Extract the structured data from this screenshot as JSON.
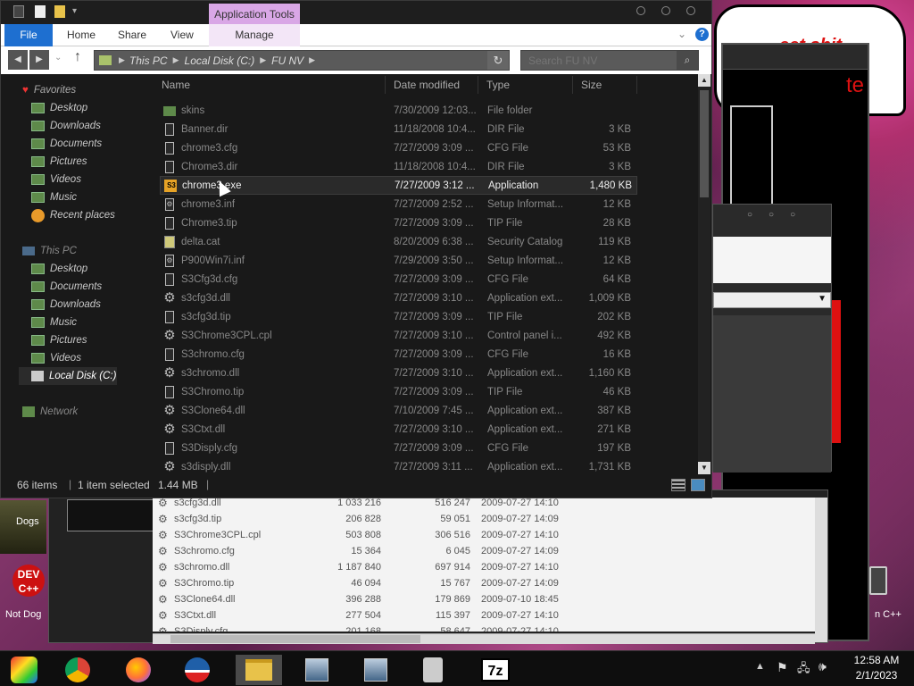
{
  "explorer": {
    "context_tab": "Application Tools",
    "tabs": [
      "File",
      "Home",
      "Share",
      "View",
      "Manage"
    ],
    "breadcrumb": [
      "This PC",
      "Local Disk (C:)",
      "FU NV"
    ],
    "search_placeholder": "Search FU NV",
    "columns": [
      "Name",
      "Date modified",
      "Type",
      "Size"
    ],
    "nav": {
      "favorites": "Favorites",
      "fav_items": [
        "Desktop",
        "Downloads",
        "Documents",
        "Pictures",
        "Videos",
        "Music",
        "Recent places"
      ],
      "this_pc": "This PC",
      "pc_items": [
        "Desktop",
        "Documents",
        "Downloads",
        "Music",
        "Pictures",
        "Videos",
        "Local Disk (C:)"
      ],
      "network": "Network"
    },
    "files": [
      {
        "name": "skins",
        "date": "7/30/2009 12:03...",
        "type": "File folder",
        "size": "",
        "icon": "folder-icon"
      },
      {
        "name": "Banner.dir",
        "date": "11/18/2008 10:4...",
        "type": "DIR File",
        "size": "3 KB",
        "icon": "file-icon"
      },
      {
        "name": "chrome3.cfg",
        "date": "7/27/2009 3:09 ...",
        "type": "CFG File",
        "size": "53 KB",
        "icon": "file-icon"
      },
      {
        "name": "Chrome3.dir",
        "date": "11/18/2008 10:4...",
        "type": "DIR File",
        "size": "3 KB",
        "icon": "file-icon"
      },
      {
        "name": "chrome3.exe",
        "date": "7/27/2009 3:12 ...",
        "type": "Application",
        "size": "1,480 KB",
        "icon": "s3-app-icon"
      },
      {
        "name": "chrome3.inf",
        "date": "7/27/2009 2:52 ...",
        "type": "Setup Informat...",
        "size": "12 KB",
        "icon": "setup-icon"
      },
      {
        "name": "Chrome3.tip",
        "date": "7/27/2009 3:09 ...",
        "type": "TIP File",
        "size": "28 KB",
        "icon": "file-icon"
      },
      {
        "name": "delta.cat",
        "date": "8/20/2009 6:38 ...",
        "type": "Security Catalog",
        "size": "119 KB",
        "icon": "catalog-icon"
      },
      {
        "name": "P900Win7i.inf",
        "date": "7/29/2009 3:50 ...",
        "type": "Setup Informat...",
        "size": "12 KB",
        "icon": "setup-icon"
      },
      {
        "name": "S3Cfg3d.cfg",
        "date": "7/27/2009 3:09 ...",
        "type": "CFG File",
        "size": "64 KB",
        "icon": "file-icon"
      },
      {
        "name": "s3cfg3d.dll",
        "date": "7/27/2009 3:10 ...",
        "type": "Application ext...",
        "size": "1,009 KB",
        "icon": "gear-icon"
      },
      {
        "name": "s3cfg3d.tip",
        "date": "7/27/2009 3:09 ...",
        "type": "TIP File",
        "size": "202 KB",
        "icon": "file-icon"
      },
      {
        "name": "S3Chrome3CPL.cpl",
        "date": "7/27/2009 3:10 ...",
        "type": "Control panel i...",
        "size": "492 KB",
        "icon": "gear-icon"
      },
      {
        "name": "S3chromo.cfg",
        "date": "7/27/2009 3:09 ...",
        "type": "CFG File",
        "size": "16 KB",
        "icon": "file-icon"
      },
      {
        "name": "s3chromo.dll",
        "date": "7/27/2009 3:10 ...",
        "type": "Application ext...",
        "size": "1,160 KB",
        "icon": "gear-icon"
      },
      {
        "name": "S3Chromo.tip",
        "date": "7/27/2009 3:09 ...",
        "type": "TIP File",
        "size": "46 KB",
        "icon": "file-icon"
      },
      {
        "name": "S3Clone64.dll",
        "date": "7/10/2009 7:45 ...",
        "type": "Application ext...",
        "size": "387 KB",
        "icon": "gear-icon"
      },
      {
        "name": "S3Ctxt.dll",
        "date": "7/27/2009 3:10 ...",
        "type": "Application ext...",
        "size": "271 KB",
        "icon": "gear-icon"
      },
      {
        "name": "S3Disply.cfg",
        "date": "7/27/2009 3:09 ...",
        "type": "CFG File",
        "size": "197 KB",
        "icon": "file-icon"
      },
      {
        "name": "s3disply.dll",
        "date": "7/27/2009 3:11 ...",
        "type": "Application ext...",
        "size": "1,731 KB",
        "icon": "gear-icon"
      }
    ],
    "status": {
      "count": "66 items",
      "selected": "1 item selected",
      "size": "1.44 MB"
    }
  },
  "background_list": {
    "rows": [
      {
        "name": "s3cfg3d.dll",
        "size": "1 033 216",
        "packed": "516 247",
        "date": "2009-07-27 14:10"
      },
      {
        "name": "s3cfg3d.tip",
        "size": "206 828",
        "packed": "59 051",
        "date": "2009-07-27 14:09"
      },
      {
        "name": "S3Chrome3CPL.cpl",
        "size": "503 808",
        "packed": "306 516",
        "date": "2009-07-27 14:10"
      },
      {
        "name": "S3chromo.cfg",
        "size": "15 364",
        "packed": "6 045",
        "date": "2009-07-27 14:09"
      },
      {
        "name": "s3chromo.dll",
        "size": "1 187 840",
        "packed": "697 914",
        "date": "2009-07-27 14:10"
      },
      {
        "name": "S3Chromo.tip",
        "size": "46 094",
        "packed": "15 767",
        "date": "2009-07-27 14:09"
      },
      {
        "name": "S3Clone64.dll",
        "size": "396 288",
        "packed": "179 869",
        "date": "2009-07-10 18:45"
      },
      {
        "name": "S3Ctxt.dll",
        "size": "277 504",
        "packed": "115 397",
        "date": "2009-07-27 14:10"
      },
      {
        "name": "S3Disply.cfg",
        "size": "201 168",
        "packed": "58 647",
        "date": "2009-07-27 14:10"
      }
    ]
  },
  "desktop": {
    "icon_label_1": "Dogs",
    "icon_label_2": "Not Dog",
    "icon_label_3": "n C++",
    "sticker_text_1": "eet shit",
    "sticker_text_2": "te"
  },
  "taskbar": {
    "time": "12:58 AM",
    "date": "2/1/2023",
    "seven_zip": "7z"
  },
  "colors": {
    "accent": "#1e6fd0",
    "context_tab": "#d9a7e6",
    "selected_row": "#2a2a2a"
  }
}
